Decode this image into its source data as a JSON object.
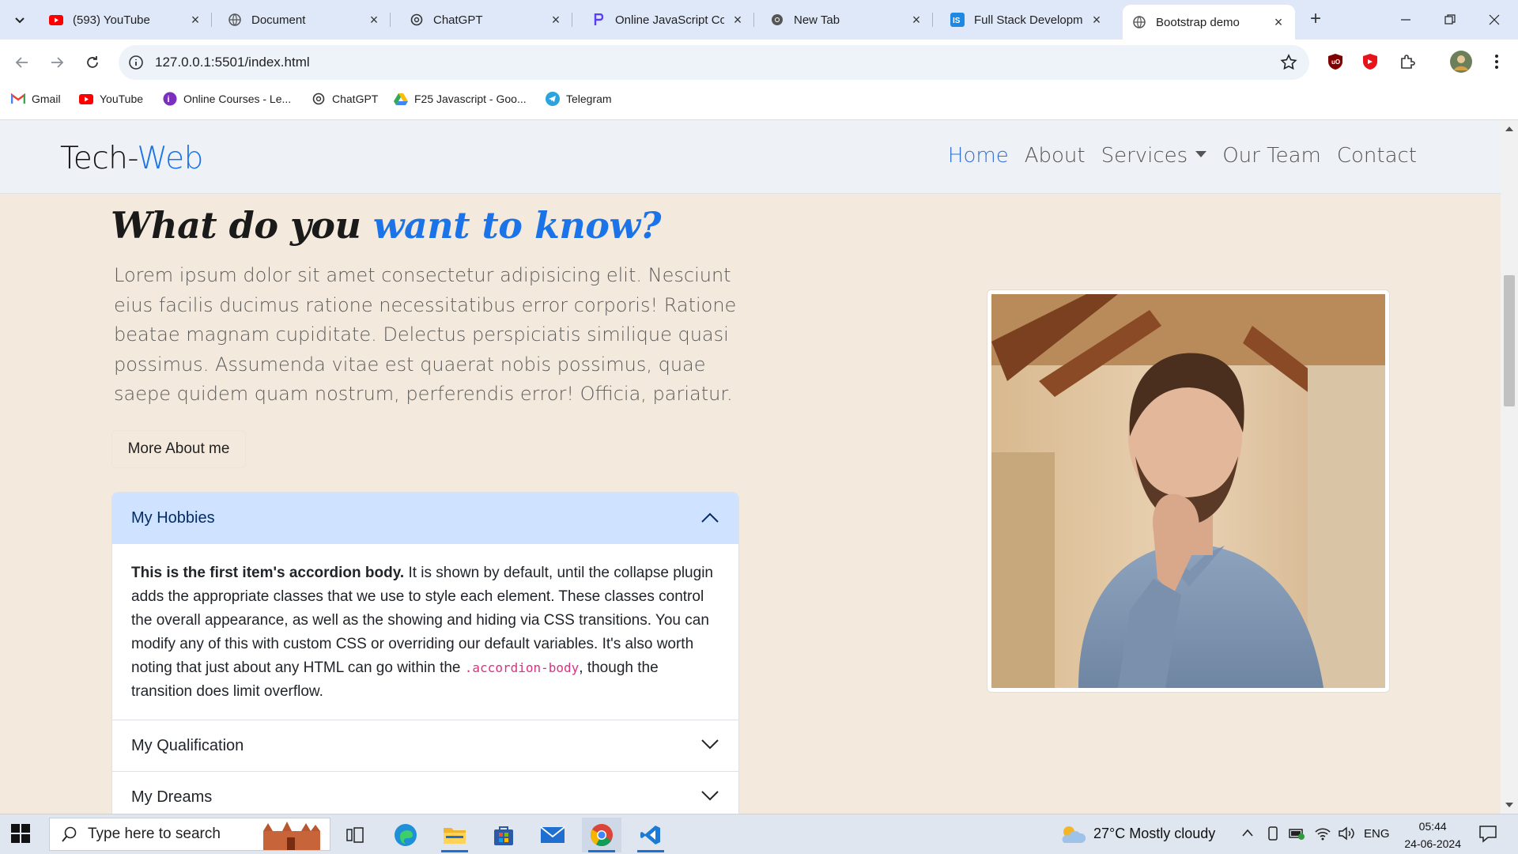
{
  "browser": {
    "tabs": [
      {
        "title": "(593) YouTube",
        "icon": "youtube-icon"
      },
      {
        "title": "Document",
        "icon": "globe-icon"
      },
      {
        "title": "ChatGPT",
        "icon": "chatgpt-icon"
      },
      {
        "title": "Online JavaScript Co",
        "icon": "programiz-icon"
      },
      {
        "title": "New Tab",
        "icon": "chrome-icon"
      },
      {
        "title": "Full Stack Developme",
        "icon": "fullstack-icon"
      },
      {
        "title": "Bootstrap demo",
        "icon": "globe-icon",
        "active": true
      }
    ],
    "url": "127.0.0.1:5501/index.html",
    "bookmarks": [
      {
        "label": "Gmail",
        "icon": "gmail-icon"
      },
      {
        "label": "YouTube",
        "icon": "youtube-icon"
      },
      {
        "label": "Online Courses - Le...",
        "icon": "udemy-icon"
      },
      {
        "label": "ChatGPT",
        "icon": "chatgpt-icon"
      },
      {
        "label": "F25 Javascript - Goo...",
        "icon": "google-drive-icon"
      },
      {
        "label": "Telegram",
        "icon": "telegram-icon"
      }
    ]
  },
  "site": {
    "brand_main": "Tech-",
    "brand_accent": "Web",
    "nav": [
      {
        "label": "Home",
        "active": true
      },
      {
        "label": "About"
      },
      {
        "label": "Services",
        "dropdown": true
      },
      {
        "label": "Our Team"
      },
      {
        "label": "Contact"
      }
    ],
    "heading_main": "What do you ",
    "heading_accent": "want to know?",
    "lead": "Lorem ipsum dolor sit amet consectetur adipisicing elit. Nesciunt eius facilis ducimus ratione necessitatibus error corporis! Ratione beatae magnam cupiditate. Delectus perspiciatis similique quasi possimus. Assumenda vitae est quaerat nobis possimus, quae saepe quidem quam nostrum, perferendis error! Officia, pariatur.",
    "more_button": "More About me",
    "accordion": [
      {
        "title": "My Hobbies",
        "expanded": true
      },
      {
        "title": "My Qualification",
        "expanded": false
      },
      {
        "title": "My Dreams",
        "expanded": false
      }
    ],
    "accordion_body": {
      "strong": "This is the first item's accordion body.",
      "text1": " It is shown by default, until the collapse plugin adds the appropriate classes that we use to style each element. These classes control the overall appearance, as well as the showing and hiding via CSS transitions. You can modify any of this with custom CSS or overriding our default variables. It's also worth noting that just about any HTML can go within the ",
      "code": ".accordion-body",
      "text2": ", though the transition does limit overflow."
    }
  },
  "taskbar": {
    "search_placeholder": "Type here to search",
    "weather": "27°C  Mostly cloudy",
    "language": "ENG",
    "time": "05:44",
    "date": "24-06-2024"
  },
  "colors": {
    "accent": "#1a73e8",
    "page_bg": "#f4e9dd",
    "accordion_active_bg": "#cfe2ff"
  }
}
